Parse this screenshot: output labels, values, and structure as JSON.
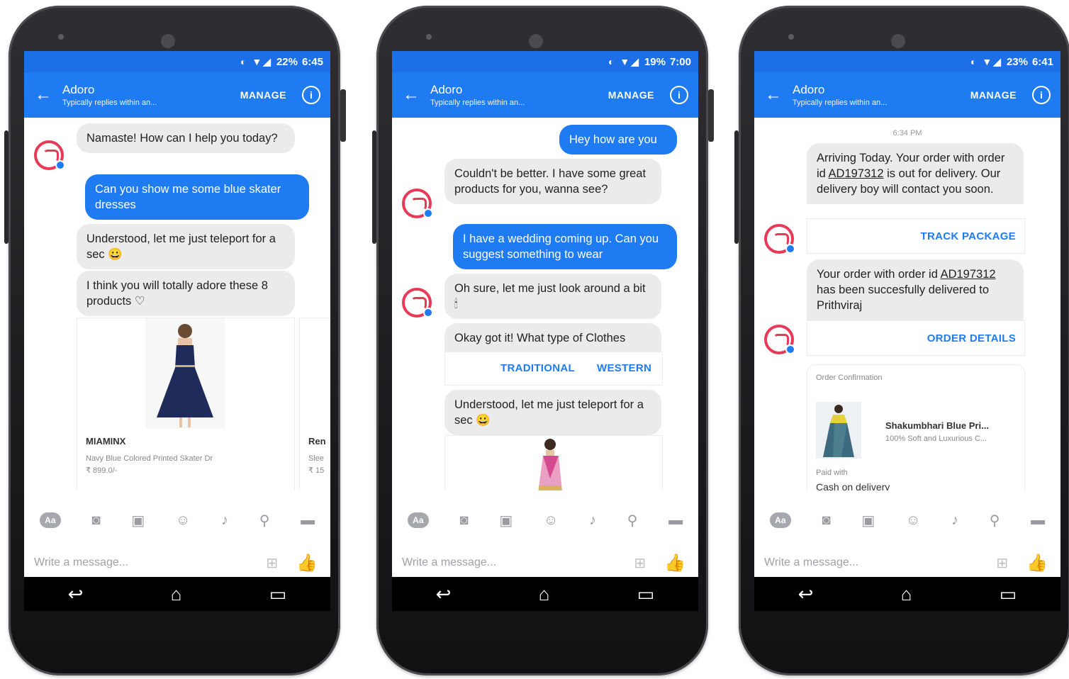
{
  "phones": [
    {
      "status": {
        "battery": "22%",
        "time": "6:45"
      },
      "header": {
        "title": "Adoro",
        "subtitle": "Typically replies within an...",
        "manage": "MANAGE"
      },
      "messages": {
        "m1": "Namaste! How can I help you today?",
        "m2": "Can you show me some blue skater dresses",
        "m3": "Understood, let me just teleport for a sec 😀",
        "m4": "I think you will totally adore these 8 products ♡"
      },
      "product": {
        "title": "MIAMINX",
        "desc": "Navy Blue Colored Printed Skater Dr",
        "price": "₹ 899.0/-",
        "next_title": "Ren",
        "next_desc": "Slee",
        "next_price": "₹ 15"
      },
      "compose": {
        "placeholder": "Write a message..."
      }
    },
    {
      "status": {
        "battery": "19%",
        "time": "7:00"
      },
      "header": {
        "title": "Adoro",
        "subtitle": "Typically replies within an...",
        "manage": "MANAGE"
      },
      "messages": {
        "m1": "Hey how are you",
        "m2": "Couldn't be better. I have some great products for you, wanna see?",
        "m3": "I have a wedding coming up. Can you suggest something to wear",
        "m4": "Oh sure, let me just look around a bit 🕯",
        "m5": "Okay got it! What type of Clothes",
        "m6": "Understood, let me just teleport for a sec 😀"
      },
      "quick_replies": [
        "TRADITIONAL",
        "WESTERN"
      ],
      "compose": {
        "placeholder": "Write a message..."
      }
    },
    {
      "status": {
        "battery": "23%",
        "time": "6:41"
      },
      "header": {
        "title": "Adoro",
        "subtitle": "Typically replies within an...",
        "manage": "MANAGE"
      },
      "timestamp": "6:34 PM",
      "messages": {
        "m1_a": "Arriving Today. Your order with order id ",
        "m1_id": "AD197312",
        "m1_b": " is out for delivery. Our delivery boy will contact you soon.",
        "m1_btn": "TRACK PACKAGE",
        "m2_a": "Your order with order id ",
        "m2_id": "AD197312",
        "m2_b": " has been succesfully delivered to Prithviraj",
        "m2_btn": "ORDER DETAILS"
      },
      "receipt": {
        "header": "Order Confirmation",
        "item_title": "Shakumbhari Blue Pri...",
        "item_desc": "100% Soft and Luxurious C...",
        "paid_label": "Paid with",
        "paid_value": "Cash on delivery"
      },
      "compose": {
        "placeholder": "Write a message..."
      }
    }
  ],
  "colors": {
    "brand_blue": "#1e7bf2",
    "status_blue": "#1c6fe6",
    "avatar_red": "#e73a57"
  }
}
